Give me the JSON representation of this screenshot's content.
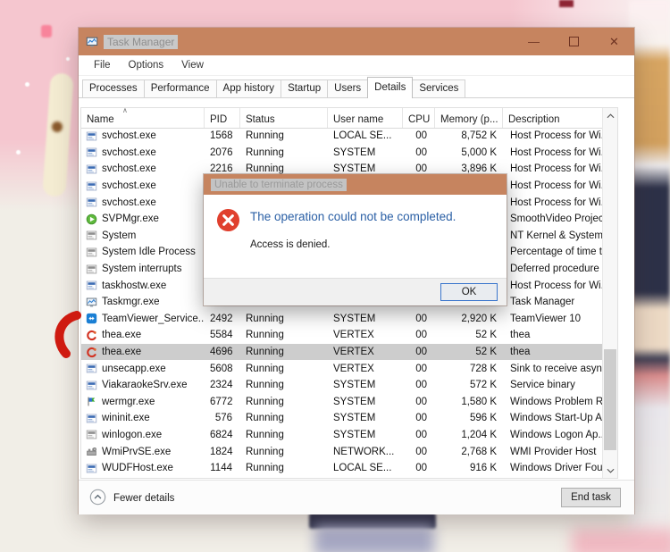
{
  "colors": {
    "titlebar": "#c6845f",
    "error_red": "#e0402e",
    "dialog_main_text": "#2a5fa5",
    "selected_row": "#cdcdcd",
    "annotation_red": "#cf1a10"
  },
  "window": {
    "title": "Task Manager",
    "menu": [
      {
        "label": "File"
      },
      {
        "label": "Options"
      },
      {
        "label": "View"
      }
    ],
    "tabs": [
      {
        "label": "Processes",
        "active": false
      },
      {
        "label": "Performance",
        "active": false
      },
      {
        "label": "App history",
        "active": false
      },
      {
        "label": "Startup",
        "active": false
      },
      {
        "label": "Users",
        "active": false
      },
      {
        "label": "Details",
        "active": true
      },
      {
        "label": "Services",
        "active": false
      }
    ],
    "table": {
      "columns": [
        {
          "id": "name",
          "label": "Name",
          "sorted": true
        },
        {
          "id": "pid",
          "label": "PID"
        },
        {
          "id": "status",
          "label": "Status"
        },
        {
          "id": "user",
          "label": "User name"
        },
        {
          "id": "cpu",
          "label": "CPU"
        },
        {
          "id": "mem",
          "label": "Memory (p..."
        },
        {
          "id": "desc",
          "label": "Description"
        }
      ],
      "rows": [
        {
          "icon": "app-window-icon",
          "name": "svchost.exe",
          "pid": "1568",
          "status": "Running",
          "user": "LOCAL SE...",
          "cpu": "00",
          "mem": "8,752 K",
          "desc": "Host Process for Wi...",
          "selected": false
        },
        {
          "icon": "app-window-icon",
          "name": "svchost.exe",
          "pid": "2076",
          "status": "Running",
          "user": "SYSTEM",
          "cpu": "00",
          "mem": "5,000 K",
          "desc": "Host Process for Wi...",
          "selected": false
        },
        {
          "icon": "app-window-icon",
          "name": "svchost.exe",
          "pid": "2216",
          "status": "Running",
          "user": "SYSTEM",
          "cpu": "00",
          "mem": "3,896 K",
          "desc": "Host Process for Wi...",
          "selected": false
        },
        {
          "icon": "app-window-icon",
          "name": "svchost.exe",
          "pid": "",
          "status": "",
          "user": "",
          "cpu": "",
          "mem": "",
          "desc": "Host Process for Wi...",
          "selected": false
        },
        {
          "icon": "app-window-icon",
          "name": "svchost.exe",
          "pid": "",
          "status": "",
          "user": "",
          "cpu": "",
          "mem": "",
          "desc": "Host Process for Wi...",
          "selected": false
        },
        {
          "icon": "svp-play-icon",
          "name": "SVPMgr.exe",
          "pid": "",
          "status": "",
          "user": "",
          "cpu": "",
          "mem": "",
          "desc": "SmoothVideo Projec...",
          "selected": false
        },
        {
          "icon": "system-window-icon",
          "name": "System",
          "pid": "",
          "status": "",
          "user": "",
          "cpu": "",
          "mem": "",
          "desc": "NT Kernel & System",
          "selected": false
        },
        {
          "icon": "system-window-icon",
          "name": "System Idle Process",
          "pid": "",
          "status": "",
          "user": "",
          "cpu": "",
          "mem": "",
          "desc": "Percentage of time t...",
          "selected": false
        },
        {
          "icon": "system-window-icon",
          "name": "System interrupts",
          "pid": "",
          "status": "",
          "user": "",
          "cpu": "",
          "mem": "",
          "desc": "Deferred procedure ...",
          "selected": false
        },
        {
          "icon": "app-window-icon",
          "name": "taskhostw.exe",
          "pid": "",
          "status": "",
          "user": "",
          "cpu": "",
          "mem": "",
          "desc": "Host Process for Wi...",
          "selected": false
        },
        {
          "icon": "taskmgr-icon",
          "name": "Taskmgr.exe",
          "pid": "",
          "status": "",
          "user": "",
          "cpu": "",
          "mem": "",
          "desc": "Task Manager",
          "selected": false
        },
        {
          "icon": "teamviewer-icon",
          "name": "TeamViewer_Service...",
          "pid": "2492",
          "status": "Running",
          "user": "SYSTEM",
          "cpu": "00",
          "mem": "2,920 K",
          "desc": "TeamViewer 10",
          "selected": false
        },
        {
          "icon": "thea-icon",
          "name": "thea.exe",
          "pid": "5584",
          "status": "Running",
          "user": "VERTEX",
          "cpu": "00",
          "mem": "52 K",
          "desc": "thea",
          "selected": false
        },
        {
          "icon": "thea-icon",
          "name": "thea.exe",
          "pid": "4696",
          "status": "Running",
          "user": "VERTEX",
          "cpu": "00",
          "mem": "52 K",
          "desc": "thea",
          "selected": true
        },
        {
          "icon": "app-window-icon",
          "name": "unsecapp.exe",
          "pid": "5608",
          "status": "Running",
          "user": "VERTEX",
          "cpu": "00",
          "mem": "728 K",
          "desc": "Sink to receive asyn...",
          "selected": false
        },
        {
          "icon": "app-window-icon",
          "name": "ViakaraokeSrv.exe",
          "pid": "2324",
          "status": "Running",
          "user": "SYSTEM",
          "cpu": "00",
          "mem": "572 K",
          "desc": "Service binary",
          "selected": false
        },
        {
          "icon": "wermgr-icon",
          "name": "wermgr.exe",
          "pid": "6772",
          "status": "Running",
          "user": "SYSTEM",
          "cpu": "00",
          "mem": "1,580 K",
          "desc": "Windows Problem R...",
          "selected": false
        },
        {
          "icon": "app-window-icon",
          "name": "wininit.exe",
          "pid": "576",
          "status": "Running",
          "user": "SYSTEM",
          "cpu": "00",
          "mem": "596 K",
          "desc": "Windows Start-Up A...",
          "selected": false
        },
        {
          "icon": "system-window-icon",
          "name": "winlogon.exe",
          "pid": "6824",
          "status": "Running",
          "user": "SYSTEM",
          "cpu": "00",
          "mem": "1,204 K",
          "desc": "Windows Logon Ap...",
          "selected": false
        },
        {
          "icon": "wmi-icon",
          "name": "WmiPrvSE.exe",
          "pid": "1824",
          "status": "Running",
          "user": "NETWORK...",
          "cpu": "00",
          "mem": "2,768 K",
          "desc": "WMI Provider Host",
          "selected": false
        },
        {
          "icon": "app-window-icon",
          "name": "WUDFHost.exe",
          "pid": "1144",
          "status": "Running",
          "user": "LOCAL SE...",
          "cpu": "00",
          "mem": "916 K",
          "desc": "Windows Driver Fou...",
          "selected": false
        }
      ]
    },
    "footer": {
      "fewer_details_label": "Fewer details",
      "end_task_label": "End task"
    }
  },
  "dialog": {
    "title": "Unable to terminate process",
    "main_text": "The operation could not be completed.",
    "detail_text": "Access is denied.",
    "ok_label": "OK"
  }
}
